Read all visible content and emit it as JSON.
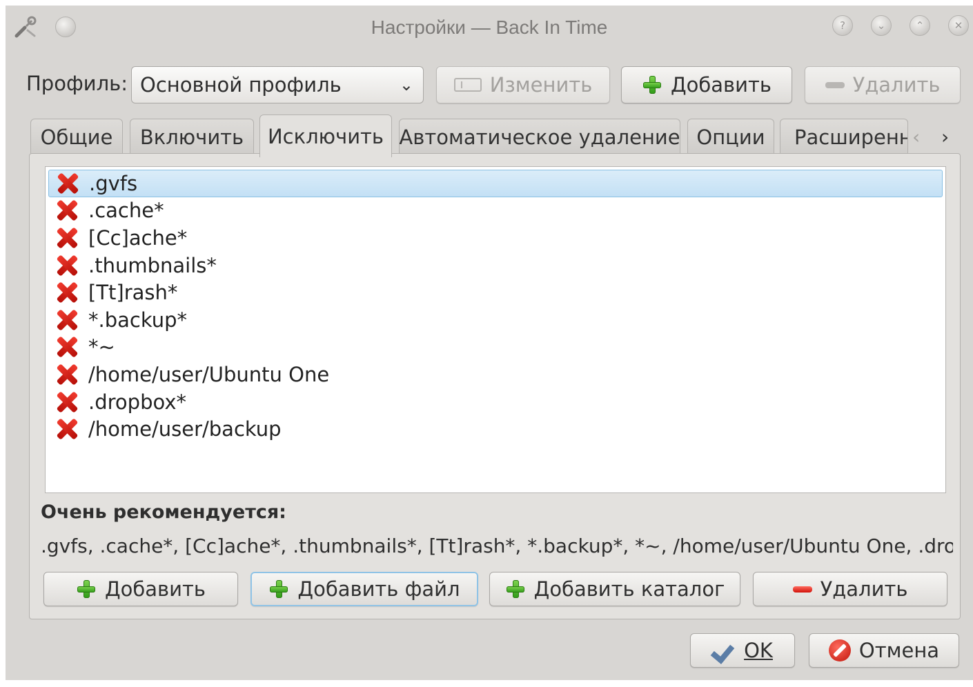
{
  "window": {
    "title": "Настройки — Back In Time",
    "title_icon": "wrench-screwdriver-icon",
    "controls": [
      "help-icon",
      "minimize-icon",
      "maximize-icon",
      "close-icon"
    ]
  },
  "profile": {
    "label": "Профиль:",
    "selected": "Основной профиль",
    "edit_label": "Изменить",
    "add_label": "Добавить",
    "remove_label": "Удалить"
  },
  "tabs": [
    {
      "label": "Общие",
      "active": false
    },
    {
      "label": "Включить",
      "active": false
    },
    {
      "label": "Исключить",
      "active": true
    },
    {
      "label": "Автоматическое удаление",
      "active": false
    },
    {
      "label": "Опции",
      "active": false
    },
    {
      "label": "Расширенн",
      "active": false
    }
  ],
  "exclude_list": [
    {
      "pattern": ".gvfs",
      "selected": true
    },
    {
      "pattern": ".cache*",
      "selected": false
    },
    {
      "pattern": "[Cc]ache*",
      "selected": false
    },
    {
      "pattern": ".thumbnails*",
      "selected": false
    },
    {
      "pattern": "[Tt]rash*",
      "selected": false
    },
    {
      "pattern": "*.backup*",
      "selected": false
    },
    {
      "pattern": "*~",
      "selected": false
    },
    {
      "pattern": "/home/user/Ubuntu One",
      "selected": false
    },
    {
      "pattern": ".dropbox*",
      "selected": false
    },
    {
      "pattern": "/home/user/backup",
      "selected": false
    }
  ],
  "recommended": {
    "label": "Очень рекомендуется:",
    "text": ".gvfs, .cache*, [Cc]ache*, .thumbnails*, [Tt]rash*, *.backup*, *~, /home/user/Ubuntu One, .dropbox*"
  },
  "list_actions": {
    "add": "Добавить",
    "add_file": "Добавить файл",
    "add_folder": "Добавить каталог",
    "remove": "Удалить"
  },
  "dialog": {
    "ok_label": "OK",
    "cancel_label": "Отмена"
  },
  "colors": {
    "window_bg": "#d8d6d3",
    "selection": "#c3e0f5",
    "add_green": "#3aa81f",
    "remove_red": "#d1120a"
  }
}
